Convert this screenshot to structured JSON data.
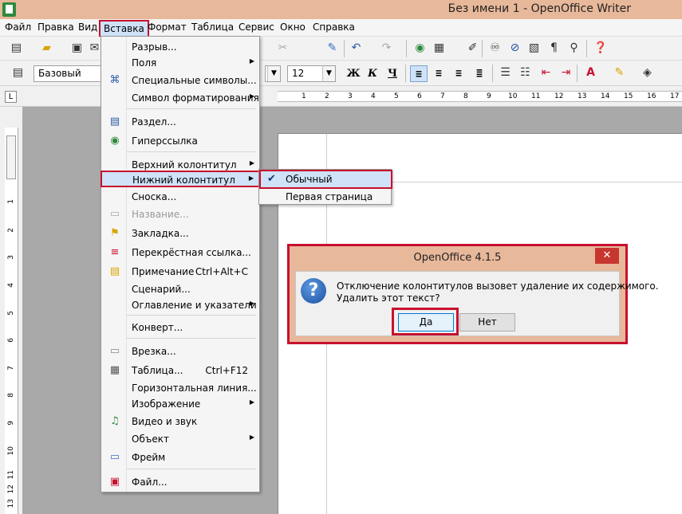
{
  "window": {
    "title": "Без имени 1 - OpenOffice Writer"
  },
  "menubar": {
    "items": [
      "Файл",
      "Правка",
      "Вид",
      "Вставка",
      "Формат",
      "Таблица",
      "Сервис",
      "Окно",
      "Справка"
    ]
  },
  "formatting": {
    "style": "Базовый",
    "font_size": "12",
    "bold": "Ж",
    "italic": "К",
    "underline": "Ч"
  },
  "ruler": {
    "h_numbers": [
      "1",
      "2",
      "3",
      "4",
      "5",
      "6",
      "7",
      "8",
      "9",
      "10",
      "11",
      "12",
      "13",
      "14",
      "15",
      "16",
      "17"
    ],
    "v_numbers": [
      "1",
      "2",
      "3",
      "4",
      "5",
      "6",
      "7",
      "8",
      "9",
      "10",
      "11",
      "12",
      "13"
    ]
  },
  "insert_menu": {
    "items": [
      {
        "label": "Разрыв...",
        "icon": ""
      },
      {
        "label": "Поля",
        "icon": "",
        "submenu": true
      },
      {
        "label": "Специальные символы...",
        "icon": "omega-icon"
      },
      {
        "label": "Символ форматирования",
        "icon": "",
        "submenu": true
      },
      {
        "label": "Раздел...",
        "icon": "section-icon"
      },
      {
        "label": "Гиперссылка",
        "icon": "hyperlink-icon"
      },
      {
        "label": "Верхний колонтитул",
        "icon": "",
        "submenu": true
      },
      {
        "label": "Нижний колонтитул",
        "icon": "",
        "submenu": true,
        "highlighted": true
      },
      {
        "label": "Сноска...",
        "icon": ""
      },
      {
        "label": "Название...",
        "icon": "caption-icon",
        "disabled": true
      },
      {
        "label": "Закладка...",
        "icon": "bookmark-icon"
      },
      {
        "label": "Перекрёстная ссылка...",
        "icon": "crossref-icon"
      },
      {
        "label": "Примечание",
        "icon": "comment-icon",
        "shortcut": "Ctrl+Alt+C"
      },
      {
        "label": "Сценарий...",
        "icon": ""
      },
      {
        "label": "Оглавление и указатели",
        "icon": "",
        "submenu": true
      },
      {
        "label": "Конверт...",
        "icon": ""
      },
      {
        "label": "Врезка...",
        "icon": "frame-icon"
      },
      {
        "label": "Таблица...",
        "icon": "table-icon",
        "shortcut": "Ctrl+F12"
      },
      {
        "label": "Горизонтальная линия...",
        "icon": ""
      },
      {
        "label": "Изображение",
        "icon": "",
        "submenu": true
      },
      {
        "label": "Видео и звук",
        "icon": "media-icon"
      },
      {
        "label": "Объект",
        "icon": "",
        "submenu": true
      },
      {
        "label": "Фрейм",
        "icon": "floating-frame-icon"
      },
      {
        "label": "Файл...",
        "icon": "insert-file-icon"
      }
    ]
  },
  "footer_submenu": {
    "normal": "Обычный",
    "first_page": "Первая страница"
  },
  "dialog": {
    "title": "OpenOffice 4.1.5",
    "close": "✕",
    "message_line1": "Отключение колонтитулов вызовет удаление их содержимого.",
    "message_line2": "Удалить этот текст?",
    "yes": "Да",
    "no": "Нет"
  },
  "colors": {
    "titlebar": "#e8b89a",
    "highlight_frame": "#c8102e",
    "menu_highlight": "#cfe2f8"
  }
}
